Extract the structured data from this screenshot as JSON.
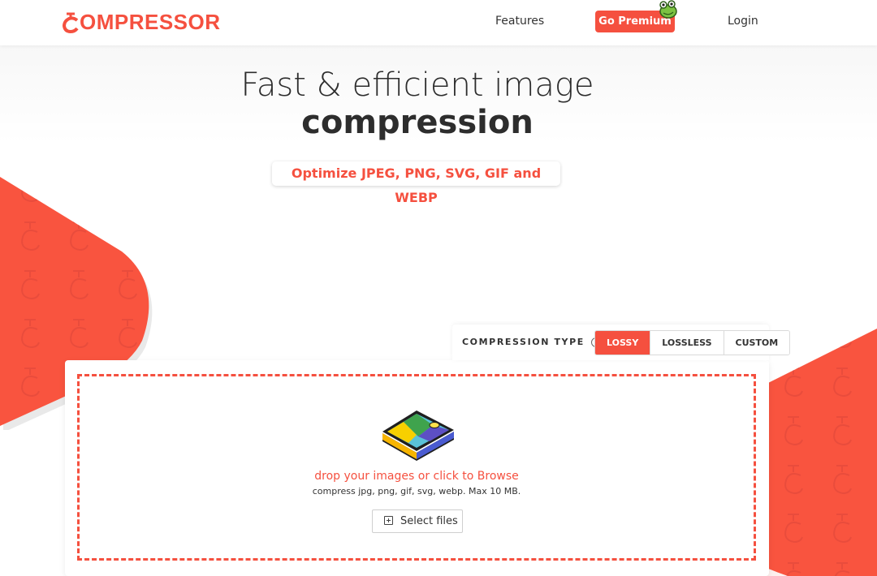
{
  "header": {
    "logo_text": "OMPRESSOR",
    "nav": {
      "features": "Features",
      "premium": "Go Premium",
      "login": "Login"
    }
  },
  "hero": {
    "title_line1": "Fast & efficient image",
    "title_line2": "compression",
    "badge": "Optimize JPEG, PNG, SVG, GIF and WEBP"
  },
  "compression_type": {
    "label": "COMPRESSION TYPE",
    "help_glyph": "?",
    "separator": ":",
    "options": [
      "LOSSY",
      "LOSSLESS",
      "CUSTOM"
    ],
    "selected": "LOSSY"
  },
  "upload": {
    "title": "drop your images or click to Browse",
    "subtitle": "compress jpg, png, gif, svg, webp. Max 10 MB.",
    "button": "Select files"
  },
  "colors": {
    "brand": "#f5503f",
    "text": "#2d2d2d"
  }
}
